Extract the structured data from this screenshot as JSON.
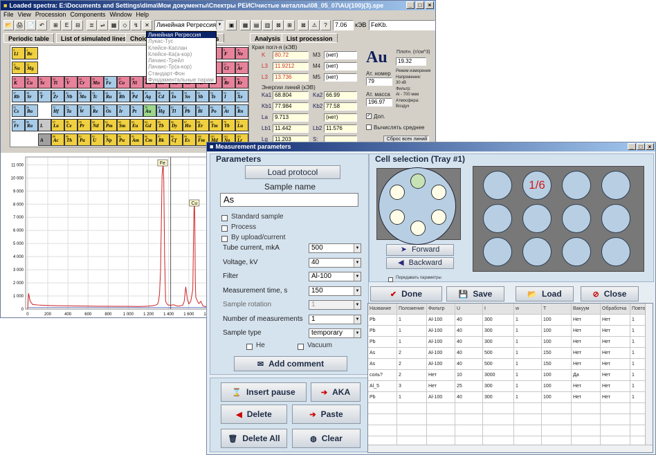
{
  "main_window": {
    "title": "Loaded spectra: E:\\Documents and Settings\\dima\\Мои документы\\Спектры РЕИС\\чистые металлы\\08_05_07\\AU(100)(3).spe",
    "controls": {
      "min": "_",
      "max": "□",
      "close": "×"
    },
    "menu": [
      "File",
      "View",
      "Procession",
      "Components",
      "Window",
      "Help"
    ],
    "toolbar": {
      "buttons_left": [
        "📂",
        "🖨",
        "📄",
        "↶",
        "⊞",
        "E",
        "⊟",
        "≣",
        "⇌",
        "▦",
        "◇",
        "↯",
        "✕"
      ],
      "method_combo": "Линейная Регрессия",
      "buttons_right": [
        "▣",
        "▦",
        "▤",
        "▥",
        "⊠",
        "⊞",
        "⊠",
        "⚠",
        "?"
      ],
      "energy_value": "7.06",
      "energy_unit": "кЭВ",
      "line_value": "FeKb."
    },
    "method_dropdown": {
      "selected": "Линейная Регрессия",
      "options": [
        "Лукас-Тус",
        "Клейсе-Каплан",
        "Клейсе-Ка(а-кор)",
        "Лачанс-Трейл",
        "Лачанс-Тр(а-кор)",
        "Стандарт-Фон",
        "Фундаментальные парам"
      ]
    },
    "tabs": [
      "Periodic table",
      "List of simulated lines",
      "Choice",
      "a modes",
      "Analysis",
      "List procession"
    ],
    "periodic_table": [
      {
        "s": "Li",
        "z": "3",
        "c": "yl",
        "col": 0,
        "row": 0
      },
      {
        "s": "Be",
        "z": "4",
        "c": "yl",
        "col": 1,
        "row": 0
      },
      {
        "s": "B",
        "z": "5",
        "c": "pk",
        "col": 12,
        "row": 0
      },
      {
        "s": "C",
        "z": "6",
        "c": "pk",
        "col": 13,
        "row": 0
      },
      {
        "s": "N",
        "z": "7",
        "c": "pk",
        "col": 14,
        "row": 0
      },
      {
        "s": "O",
        "z": "8",
        "c": "pk",
        "col": 15,
        "row": 0
      },
      {
        "s": "F",
        "z": "9",
        "c": "pk",
        "col": 16,
        "row": 0
      },
      {
        "s": "Ne",
        "z": "10",
        "c": "pk",
        "col": 17,
        "row": 0
      },
      {
        "s": "Na",
        "z": "11",
        "c": "yl",
        "col": 0,
        "row": 1
      },
      {
        "s": "Mg",
        "z": "12",
        "c": "yl",
        "col": 1,
        "row": 1
      },
      {
        "s": "Al",
        "z": "13",
        "c": "pk",
        "col": 12,
        "row": 1
      },
      {
        "s": "Si",
        "z": "14",
        "c": "pk",
        "col": 13,
        "row": 1
      },
      {
        "s": "P",
        "z": "15",
        "c": "pk",
        "col": 14,
        "row": 1
      },
      {
        "s": "S",
        "z": "16",
        "c": "pk",
        "col": 15,
        "row": 1
      },
      {
        "s": "Cl",
        "z": "17",
        "c": "pk",
        "col": 16,
        "row": 1
      },
      {
        "s": "Ar",
        "z": "18",
        "c": "pk",
        "col": 17,
        "row": 1
      },
      {
        "s": "K",
        "z": "19",
        "c": "pk",
        "col": 0,
        "row": 2
      },
      {
        "s": "Ca",
        "z": "20",
        "c": "pk",
        "col": 1,
        "row": 2
      },
      {
        "s": "Sc",
        "z": "21",
        "c": "pk",
        "col": 2,
        "row": 2
      },
      {
        "s": "Ti",
        "z": "22",
        "c": "pk",
        "col": 3,
        "row": 2
      },
      {
        "s": "V",
        "z": "23",
        "c": "pk",
        "col": 4,
        "row": 2
      },
      {
        "s": "Cr",
        "z": "24",
        "c": "pk",
        "col": 5,
        "row": 2
      },
      {
        "s": "Mn",
        "z": "25",
        "c": "pk",
        "col": 6,
        "row": 2
      },
      {
        "s": "Fe",
        "z": "26",
        "c": "bl",
        "col": 7,
        "row": 2
      },
      {
        "s": "Co",
        "z": "27",
        "c": "pk",
        "col": 8,
        "row": 2
      },
      {
        "s": "Ni",
        "z": "28",
        "c": "pk",
        "col": 9,
        "row": 2
      },
      {
        "s": "Cu",
        "z": "29",
        "c": "pk",
        "col": 10,
        "row": 2
      },
      {
        "s": "Zn",
        "z": "30",
        "c": "pk",
        "col": 11,
        "row": 2
      },
      {
        "s": "Ga",
        "z": "31",
        "c": "pk",
        "col": 12,
        "row": 2
      },
      {
        "s": "Ge",
        "z": "32",
        "c": "pk",
        "col": 13,
        "row": 2
      },
      {
        "s": "As",
        "z": "33",
        "c": "pk",
        "col": 14,
        "row": 2
      },
      {
        "s": "Se",
        "z": "34",
        "c": "pk",
        "col": 15,
        "row": 2
      },
      {
        "s": "Br",
        "z": "35",
        "c": "pk",
        "col": 16,
        "row": 2
      },
      {
        "s": "Kr",
        "z": "36",
        "c": "pk",
        "col": 17,
        "row": 2
      },
      {
        "s": "Rb",
        "z": "37",
        "c": "bl",
        "col": 0,
        "row": 3
      },
      {
        "s": "Sr",
        "z": "38",
        "c": "bl",
        "col": 1,
        "row": 3
      },
      {
        "s": "Y",
        "z": "39",
        "c": "bl",
        "col": 2,
        "row": 3
      },
      {
        "s": "Zr",
        "z": "40",
        "c": "bl",
        "col": 3,
        "row": 3
      },
      {
        "s": "Nb",
        "z": "41",
        "c": "bl",
        "col": 4,
        "row": 3
      },
      {
        "s": "Mo",
        "z": "42",
        "c": "bl",
        "col": 5,
        "row": 3
      },
      {
        "s": "Tc",
        "z": "43",
        "c": "bl",
        "col": 6,
        "row": 3
      },
      {
        "s": "Ru",
        "z": "44",
        "c": "bl",
        "col": 7,
        "row": 3
      },
      {
        "s": "Rh",
        "z": "45",
        "c": "bl",
        "col": 8,
        "row": 3
      },
      {
        "s": "Pd",
        "z": "46",
        "c": "bl",
        "col": 9,
        "row": 3
      },
      {
        "s": "Ag",
        "z": "47",
        "c": "bl",
        "col": 10,
        "row": 3
      },
      {
        "s": "Cd",
        "z": "48",
        "c": "bl",
        "col": 11,
        "row": 3
      },
      {
        "s": "In",
        "z": "49",
        "c": "bl",
        "col": 12,
        "row": 3
      },
      {
        "s": "Sn",
        "z": "50",
        "c": "bl",
        "col": 13,
        "row": 3
      },
      {
        "s": "Sb",
        "z": "51",
        "c": "bl",
        "col": 14,
        "row": 3
      },
      {
        "s": "Te",
        "z": "52",
        "c": "bl",
        "col": 15,
        "row": 3
      },
      {
        "s": "I",
        "z": "53",
        "c": "bl",
        "col": 16,
        "row": 3
      },
      {
        "s": "Xe",
        "z": "54",
        "c": "bl",
        "col": 17,
        "row": 3
      },
      {
        "s": "Cs",
        "z": "55",
        "c": "bl",
        "col": 0,
        "row": 4
      },
      {
        "s": "Ba",
        "z": "56",
        "c": "bl",
        "col": 1,
        "row": 4
      },
      {
        "s": "Hf",
        "z": "72",
        "c": "bl",
        "col": 3,
        "row": 4
      },
      {
        "s": "Ta",
        "z": "73",
        "c": "bl",
        "col": 4,
        "row": 4
      },
      {
        "s": "W",
        "z": "74",
        "c": "bl",
        "col": 5,
        "row": 4
      },
      {
        "s": "Re",
        "z": "75",
        "c": "bl",
        "col": 6,
        "row": 4
      },
      {
        "s": "Os",
        "z": "76",
        "c": "bl",
        "col": 7,
        "row": 4
      },
      {
        "s": "Ir",
        "z": "77",
        "c": "bl",
        "col": 8,
        "row": 4
      },
      {
        "s": "Pt",
        "z": "78",
        "c": "bl",
        "col": 9,
        "row": 4
      },
      {
        "s": "Au",
        "z": "79",
        "c": "gn",
        "col": 10,
        "row": 4
      },
      {
        "s": "Hg",
        "z": "80",
        "c": "bl",
        "col": 11,
        "row": 4
      },
      {
        "s": "Tl",
        "z": "81",
        "c": "bl",
        "col": 12,
        "row": 4
      },
      {
        "s": "Pb",
        "z": "82",
        "c": "bl",
        "col": 13,
        "row": 4
      },
      {
        "s": "Bi",
        "z": "83",
        "c": "bl",
        "col": 14,
        "row": 4
      },
      {
        "s": "Po",
        "z": "84",
        "c": "bl",
        "col": 15,
        "row": 4
      },
      {
        "s": "At",
        "z": "85",
        "c": "bl",
        "col": 16,
        "row": 4
      },
      {
        "s": "Rn",
        "z": "86",
        "c": "bl",
        "col": 17,
        "row": 4
      },
      {
        "s": "Fr",
        "z": "87",
        "c": "bl",
        "col": 0,
        "row": 5
      },
      {
        "s": "Ra",
        "z": "88",
        "c": "bl",
        "col": 1,
        "row": 5
      },
      {
        "s": "L",
        "z": "",
        "c": "gr",
        "col": 2,
        "row": 5
      },
      {
        "s": "La",
        "z": "57",
        "c": "yl",
        "col": 3,
        "row": 5
      },
      {
        "s": "Ce",
        "z": "58",
        "c": "yl",
        "col": 4,
        "row": 5
      },
      {
        "s": "Pr",
        "z": "59",
        "c": "yl",
        "col": 5,
        "row": 5
      },
      {
        "s": "Nd",
        "z": "60",
        "c": "yl",
        "col": 6,
        "row": 5
      },
      {
        "s": "Pm",
        "z": "61",
        "c": "yl",
        "col": 7,
        "row": 5
      },
      {
        "s": "Sm",
        "z": "62",
        "c": "yl",
        "col": 8,
        "row": 5
      },
      {
        "s": "Eu",
        "z": "63",
        "c": "yl",
        "col": 9,
        "row": 5
      },
      {
        "s": "Gd",
        "z": "64",
        "c": "yl",
        "col": 10,
        "row": 5
      },
      {
        "s": "Tb",
        "z": "65",
        "c": "yl",
        "col": 11,
        "row": 5
      },
      {
        "s": "Dy",
        "z": "66",
        "c": "yl",
        "col": 12,
        "row": 5
      },
      {
        "s": "Ho",
        "z": "67",
        "c": "yl",
        "col": 13,
        "row": 5
      },
      {
        "s": "Er",
        "z": "68",
        "c": "yl",
        "col": 14,
        "row": 5
      },
      {
        "s": "Tm",
        "z": "69",
        "c": "yl",
        "col": 15,
        "row": 5
      },
      {
        "s": "Yb",
        "z": "70",
        "c": "yl",
        "col": 16,
        "row": 5
      },
      {
        "s": "Lu",
        "z": "71",
        "c": "yl",
        "col": 17,
        "row": 5
      },
      {
        "s": "A",
        "z": "",
        "c": "dg",
        "col": 2,
        "row": 6
      },
      {
        "s": "Ac",
        "z": "89",
        "c": "yl",
        "col": 3,
        "row": 6
      },
      {
        "s": "Th",
        "z": "90",
        "c": "yl",
        "col": 4,
        "row": 6
      },
      {
        "s": "Pa",
        "z": "91",
        "c": "yl",
        "col": 5,
        "row": 6
      },
      {
        "s": "U",
        "z": "92",
        "c": "yl",
        "col": 6,
        "row": 6
      },
      {
        "s": "Np",
        "z": "93",
        "c": "yl",
        "col": 7,
        "row": 6
      },
      {
        "s": "Pu",
        "z": "94",
        "c": "yl",
        "col": 8,
        "row": 6
      },
      {
        "s": "Am",
        "z": "95",
        "c": "yl",
        "col": 9,
        "row": 6
      },
      {
        "s": "Cm",
        "z": "96",
        "c": "yl",
        "col": 10,
        "row": 6
      },
      {
        "s": "Bk",
        "z": "97",
        "c": "yl",
        "col": 11,
        "row": 6
      },
      {
        "s": "Cf",
        "z": "98",
        "c": "yl",
        "col": 12,
        "row": 6
      },
      {
        "s": "Es",
        "z": "99",
        "c": "yl",
        "col": 13,
        "row": 6
      },
      {
        "s": "Fm",
        "z": "100",
        "c": "yl",
        "col": 14,
        "row": 6
      },
      {
        "s": "Md",
        "z": "101",
        "c": "yl",
        "col": 15,
        "row": 6
      },
      {
        "s": "No",
        "z": "102",
        "c": "yl",
        "col": 16,
        "row": 6
      },
      {
        "s": "Lr",
        "z": "103",
        "c": "yl",
        "col": 17,
        "row": 6
      }
    ],
    "element_info": {
      "edges_header": "Края погл-я (кЭВ)",
      "edges": [
        {
          "label": "K",
          "value": "80.72",
          "lbl2": "M3",
          "value2": "(нет)"
        },
        {
          "label": "L3",
          "value": "11.9212",
          "lbl2": "M4",
          "value2": "(нет)"
        },
        {
          "label": "L3",
          "value": "13.736",
          "lbl2": "M5",
          "value2": "(нет)"
        }
      ],
      "lines_header": "Энергии линий (кЭВ)",
      "lines": [
        {
          "label": "Ka1",
          "value": "68.804",
          "lbl2": "Ka2",
          "value2": "66.99"
        },
        {
          "label": "Kb1",
          "value": "77.984",
          "lbl2": "Kb2",
          "value2": "77.58"
        },
        {
          "label": "La",
          "value": "9.713",
          "lbl2": "",
          "value2": "(нет)"
        },
        {
          "label": "Lb1",
          "value": "11.442",
          "lbl2": "Lb2",
          "value2": "11.576"
        },
        {
          "label": "Lg",
          "value": "11.203",
          "lbl2": "S:",
          "value2": ""
        }
      ],
      "symbol": "Au",
      "density_label": "Плотн. (г/см^3)",
      "density": "19.32",
      "atomic_number_label": "Ат. номер",
      "atomic_number": "79",
      "atomic_mass_label": "Ат. масса",
      "atomic_mass": "196.97",
      "mode_info": [
        "Режим измерения",
        "Напряжение:",
        "30   кВ",
        "Фильтр:",
        "Al - 700 мкм",
        "Атмосфера:",
        "Воздух"
      ],
      "check_dop": "Доп.",
      "check_avg": "Вычислять среднее",
      "reset_btn": "Сброс всех линий"
    },
    "spectrum": {
      "y_ticks": [
        "11 000",
        "10 000",
        "9 000",
        "8 000",
        "7 000",
        "6 000",
        "5 000",
        "4 000",
        "3 000",
        "2 000",
        "1 000",
        "0"
      ],
      "x_ticks": [
        "0",
        "200",
        "400",
        "600",
        "800",
        "1 000",
        "1 200",
        "1 400",
        "1 600",
        "1 800"
      ],
      "peak_labels": [
        "Fe",
        "Cu"
      ]
    }
  },
  "chart_data": {
    "type": "line",
    "title": "",
    "xlabel": "",
    "ylabel": "",
    "xlim": [
      -20,
      1780
    ],
    "ylim": [
      0,
      11600
    ],
    "grid": true,
    "series": [
      {
        "color": "#cc2222",
        "x": [
          0,
          10,
          25,
          50,
          120,
          200,
          300,
          400,
          500,
          600,
          700,
          800,
          900,
          1000,
          1100,
          1150,
          1200,
          1240,
          1270,
          1290,
          1300,
          1310,
          1320,
          1335,
          1345,
          1352,
          1360,
          1370,
          1390,
          1420,
          1450,
          1480,
          1500,
          1520,
          1540,
          1555,
          1570,
          1585,
          1600,
          1620,
          1640,
          1650,
          1655,
          1660,
          1665,
          1670,
          1680,
          1700,
          1720,
          1740,
          1760,
          1780
        ],
        "y": [
          0,
          1200,
          600,
          350,
          300,
          280,
          260,
          250,
          240,
          230,
          220,
          220,
          210,
          210,
          200,
          210,
          230,
          260,
          300,
          380,
          600,
          1200,
          3000,
          10200,
          11100,
          9800,
          4000,
          600,
          320,
          290,
          330,
          250,
          230,
          260,
          300,
          600,
          1700,
          800,
          400,
          600,
          1500,
          7000,
          8300,
          6800,
          2000,
          900,
          700,
          420,
          600,
          250,
          200,
          180
        ]
      }
    ],
    "peak_markers": [
      {
        "label": "Fe",
        "x": 1340
      },
      {
        "label": "Cu",
        "x": 1655
      }
    ],
    "vline_x": 1420
  },
  "dialog": {
    "title": "Measurement parameters",
    "params_header": "Parameters",
    "load_protocol": "Load protocol",
    "sample_name_label": "Sample name",
    "sample_name": "As",
    "checks": [
      "Standard sample",
      "Process",
      "By upload/current"
    ],
    "fields": [
      {
        "label": "Tube current, mkA",
        "value": "500",
        "disabled": false
      },
      {
        "label": "Voltage, kV",
        "value": "40",
        "disabled": false
      },
      {
        "label": "Filter",
        "value": "Al-100",
        "disabled": false
      },
      {
        "label": "Measurement time, s",
        "value": "150",
        "disabled": false
      },
      {
        "label": "Sample rotation",
        "value": "1",
        "disabled": true
      },
      {
        "label": "Number of measurements",
        "value": "1",
        "disabled": false
      },
      {
        "label": "Sample type",
        "value": "temporary",
        "disabled": false
      }
    ],
    "atm_checks": [
      "He",
      "Vacuum"
    ],
    "add_comment": "Add comment",
    "buttons": {
      "insert_pause": "Insert pause",
      "aka": "AKA",
      "delete": "Delete",
      "paste": "Paste",
      "delete_all": "Delete All",
      "clear": "Clear"
    },
    "cell_header": "Cell selection (Tray #1)",
    "forward": "Forward",
    "backward": "Backward",
    "transfer_params": "Передавать параметры",
    "tray_label": "1/6",
    "done": "Done",
    "save": "Save",
    "load": "Load",
    "close": "Close",
    "table_headers": [
      "Название",
      "Положение",
      "Фильтр",
      "U",
      "I",
      "w",
      "T",
      "Вакуум",
      "Обработка",
      "Повтор"
    ],
    "table_rows": [
      [
        "Pb",
        "1",
        "Al-100",
        "40",
        "300",
        "1",
        "100",
        "Нет",
        "Нет",
        "1"
      ],
      [
        "Pb",
        "1",
        "Al-100",
        "40",
        "300",
        "1",
        "100",
        "Нет",
        "Нет",
        "1"
      ],
      [
        "Pb",
        "1",
        "Al-100",
        "40",
        "300",
        "1",
        "100",
        "Нет",
        "Нет",
        "1"
      ],
      [
        "As",
        "2",
        "Al-100",
        "40",
        "500",
        "1",
        "150",
        "Нет",
        "Нет",
        "1"
      ],
      [
        "As",
        "2",
        "Al-100",
        "40",
        "500",
        "1",
        "150",
        "Нет",
        "Нет",
        "1"
      ],
      [
        "соль?",
        "2",
        "Нет",
        "10",
        "3000",
        "1",
        "100",
        "Да",
        "Нет",
        "1"
      ],
      [
        "Al_5",
        "3",
        "Нет",
        "25",
        "300",
        "1",
        "100",
        "Нет",
        "Нет",
        "1"
      ],
      [
        "Pb",
        "1",
        "Al-100",
        "40",
        "300",
        "1",
        "100",
        "Нет",
        "Нет",
        "1"
      ]
    ]
  }
}
